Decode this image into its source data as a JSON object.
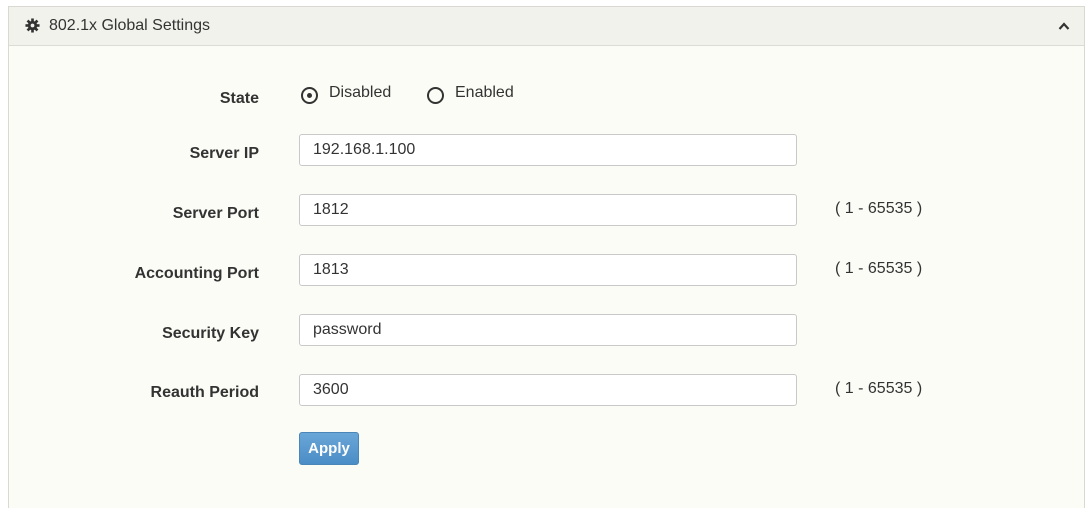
{
  "panel": {
    "title": "802.1x Global Settings",
    "header_icon": "gear-icon",
    "collapse_icon": "chevron-up-icon"
  },
  "form": {
    "state": {
      "label": "State",
      "options": [
        {
          "label": "Disabled",
          "selected": true
        },
        {
          "label": "Enabled",
          "selected": false
        }
      ]
    },
    "server_ip": {
      "label": "Server IP",
      "value": "192.168.1.100"
    },
    "server_port": {
      "label": "Server Port",
      "value": "1812",
      "range": "( 1 - 65535 )"
    },
    "accounting_port": {
      "label": "Accounting Port",
      "value": "1813",
      "range": "( 1 - 65535 )"
    },
    "security_key": {
      "label": "Security Key",
      "value": "password"
    },
    "reauth_period": {
      "label": "Reauth Period",
      "value": "3600",
      "range": "( 1 - 65535 )"
    },
    "apply_label": "Apply"
  },
  "colors": {
    "panel_background": "#fcfcf7",
    "header_background": "#f2f2ec",
    "apply_button": "#5b9bd1",
    "text": "#333333"
  }
}
